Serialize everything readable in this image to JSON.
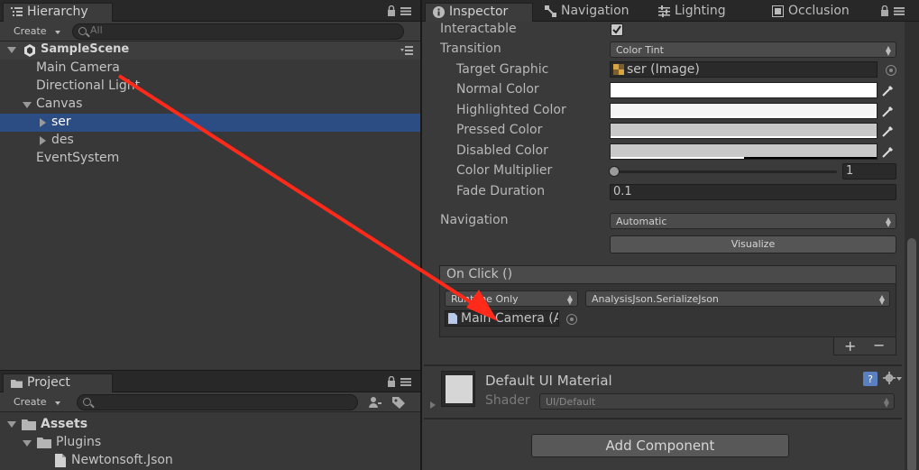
{
  "hierarchy": {
    "tab_label": "Hierarchy",
    "create_label": "Create",
    "search_placeholder": "All",
    "scene_name": "SampleScene",
    "items": [
      {
        "label": "Main Camera"
      },
      {
        "label": "Directional Light"
      },
      {
        "label": "Canvas"
      },
      {
        "label": "ser"
      },
      {
        "label": "des"
      },
      {
        "label": "EventSystem"
      }
    ]
  },
  "project": {
    "tab_label": "Project",
    "create_label": "Create",
    "search_placeholder": "",
    "items": [
      {
        "label": "Assets"
      },
      {
        "label": "Plugins"
      },
      {
        "label": "Newtonsoft.Json"
      }
    ]
  },
  "inspector": {
    "tabs": [
      {
        "label": "Inspector"
      },
      {
        "label": "Navigation"
      },
      {
        "label": "Lighting"
      },
      {
        "label": "Occlusion"
      }
    ],
    "interactable_label": "Interactable",
    "interactable_checked": true,
    "transition_label": "Transition",
    "transition_value": "Color Tint",
    "target_graphic_label": "Target Graphic",
    "target_graphic_value": "ser (Image)",
    "normal_color_label": "Normal Color",
    "normal_color": "#ffffff",
    "highlighted_color_label": "Highlighted Color",
    "highlighted_color": "#f5f5f5",
    "pressed_color_label": "Pressed Color",
    "pressed_color": "#c8c8c8",
    "disabled_color_label": "Disabled Color",
    "disabled_color": "#c8c8c8",
    "disabled_alpha": 0.5,
    "color_multiplier_label": "Color Multiplier",
    "color_multiplier_value": "1",
    "color_multiplier_slider": 0.0,
    "fade_duration_label": "Fade Duration",
    "fade_duration_value": "0.1",
    "navigation_label": "Navigation",
    "navigation_value": "Automatic",
    "visualize_label": "Visualize",
    "onclick": {
      "header": "On Click ()",
      "runtime_value": "Runtime Only",
      "function_value": "AnalysisJson.SerializeJson",
      "object_value": "Main Camera (A"
    },
    "material": {
      "name": "Default UI Material",
      "shader_label": "Shader",
      "shader_value": "UI/Default"
    },
    "add_component_label": "Add Component"
  },
  "annotation_arrow_color": "#ff2a1a",
  "selection_color": "#2c4d83"
}
